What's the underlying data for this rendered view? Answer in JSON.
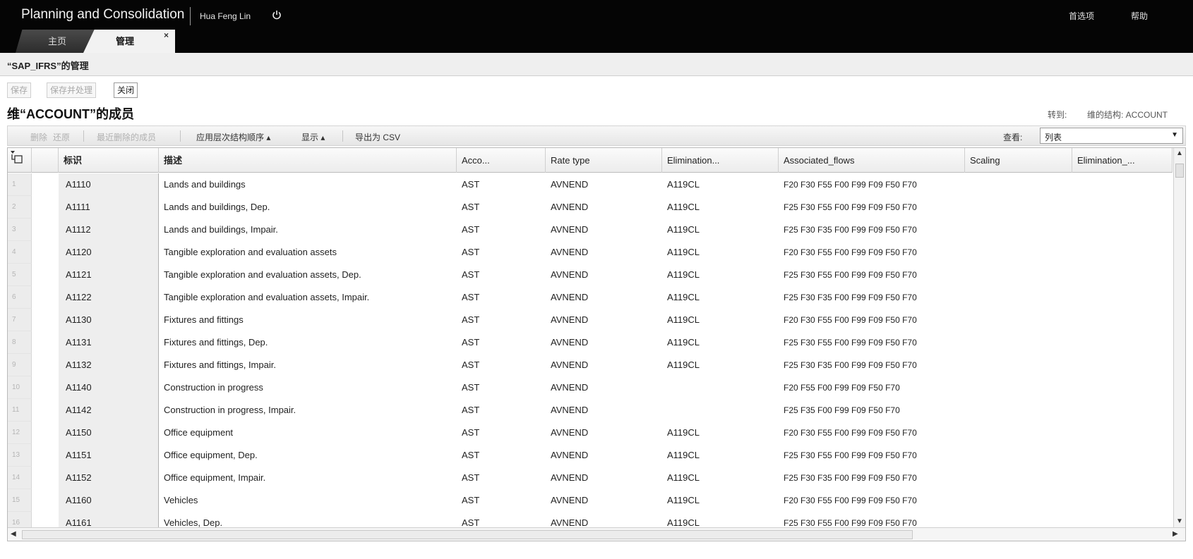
{
  "header": {
    "app_title": "Planning and Consolidation",
    "user": "Hua Feng Lin",
    "preferences": "首选项",
    "help": "帮助"
  },
  "tabs": [
    {
      "label": "主页"
    },
    {
      "label": "管理",
      "close": "×"
    }
  ],
  "subheader": {
    "title": "“SAP_IFRS”的管理"
  },
  "actions": {
    "save": "保存",
    "save_process": "保存并处理",
    "close": "关闭"
  },
  "section": {
    "title": "维“ACCOUNT”的成员",
    "goto_label": "转到:",
    "goto_value": "维的结构: ACCOUNT"
  },
  "toolbar": {
    "delete": "删除",
    "restore": "还原",
    "recently_deleted": "最近删除的成员",
    "hierarchy_order": "应用层次结构顺序 ▴",
    "display": "显示 ▴",
    "export_csv": "导出为 CSV",
    "view_label": "查看:",
    "view_value": "列表"
  },
  "columns": [
    "标识",
    "描述",
    "Acco...",
    "Rate type",
    "Elimination...",
    "Associated_flows",
    "Scaling",
    "Elimination_..."
  ],
  "rows": [
    {
      "n": "1",
      "id": "A1110",
      "desc": "Lands and buildings",
      "acc": "AST",
      "rate": "AVNEND",
      "elim": "A119CL",
      "flows": "F20 F30 F55 F00 F99 F09 F50 F70"
    },
    {
      "n": "2",
      "id": "A1111",
      "desc": "Lands and buildings, Dep.",
      "acc": "AST",
      "rate": "AVNEND",
      "elim": "A119CL",
      "flows": "F25 F30 F55 F00 F99 F09 F50 F70"
    },
    {
      "n": "3",
      "id": "A1112",
      "desc": "Lands and buildings, Impair.",
      "acc": "AST",
      "rate": "AVNEND",
      "elim": "A119CL",
      "flows": "F25 F30 F35 F00 F99 F09 F50 F70"
    },
    {
      "n": "4",
      "id": "A1120",
      "desc": "Tangible exploration and evaluation assets",
      "acc": "AST",
      "rate": "AVNEND",
      "elim": "A119CL",
      "flows": "F20 F30 F55 F00 F99 F09 F50 F70"
    },
    {
      "n": "5",
      "id": "A1121",
      "desc": "Tangible exploration and evaluation assets, Dep.",
      "acc": "AST",
      "rate": "AVNEND",
      "elim": "A119CL",
      "flows": "F25 F30 F55 F00 F99 F09 F50 F70"
    },
    {
      "n": "6",
      "id": "A1122",
      "desc": "Tangible exploration and evaluation assets, Impair.",
      "acc": "AST",
      "rate": "AVNEND",
      "elim": "A119CL",
      "flows": "F25 F30 F35 F00 F99 F09 F50 F70"
    },
    {
      "n": "7",
      "id": "A1130",
      "desc": "Fixtures and fittings",
      "acc": "AST",
      "rate": "AVNEND",
      "elim": "A119CL",
      "flows": "F20 F30 F55 F00 F99 F09 F50 F70"
    },
    {
      "n": "8",
      "id": "A1131",
      "desc": "Fixtures and fittings, Dep.",
      "acc": "AST",
      "rate": "AVNEND",
      "elim": "A119CL",
      "flows": "F25 F30 F55 F00 F99 F09 F50 F70"
    },
    {
      "n": "9",
      "id": "A1132",
      "desc": "Fixtures and fittings, Impair.",
      "acc": "AST",
      "rate": "AVNEND",
      "elim": "A119CL",
      "flows": "F25 F30 F35 F00 F99 F09 F50 F70"
    },
    {
      "n": "10",
      "id": "A1140",
      "desc": "Construction in progress",
      "acc": "AST",
      "rate": "AVNEND",
      "elim": "",
      "flows": "F20 F55 F00 F99 F09 F50 F70"
    },
    {
      "n": "11",
      "id": "A1142",
      "desc": "Construction in progress, Impair.",
      "acc": "AST",
      "rate": "AVNEND",
      "elim": "",
      "flows": "F25 F35 F00 F99 F09 F50 F70"
    },
    {
      "n": "12",
      "id": "A1150",
      "desc": "Office equipment",
      "acc": "AST",
      "rate": "AVNEND",
      "elim": "A119CL",
      "flows": "F20 F30 F55 F00 F99 F09 F50 F70"
    },
    {
      "n": "13",
      "id": "A1151",
      "desc": "Office equipment, Dep.",
      "acc": "AST",
      "rate": "AVNEND",
      "elim": "A119CL",
      "flows": "F25 F30 F55 F00 F99 F09 F50 F70"
    },
    {
      "n": "14",
      "id": "A1152",
      "desc": "Office equipment, Impair.",
      "acc": "AST",
      "rate": "AVNEND",
      "elim": "A119CL",
      "flows": "F25 F30 F35 F00 F99 F09 F50 F70"
    },
    {
      "n": "15",
      "id": "A1160",
      "desc": "Vehicles",
      "acc": "AST",
      "rate": "AVNEND",
      "elim": "A119CL",
      "flows": "F20 F30 F55 F00 F99 F09 F50 F70"
    },
    {
      "n": "16",
      "id": "A1161",
      "desc": "Vehicles, Dep.",
      "acc": "AST",
      "rate": "AVNEND",
      "elim": "A119CL",
      "flows": "F25 F30 F55 F00 F99 F09 F50 F70"
    }
  ]
}
